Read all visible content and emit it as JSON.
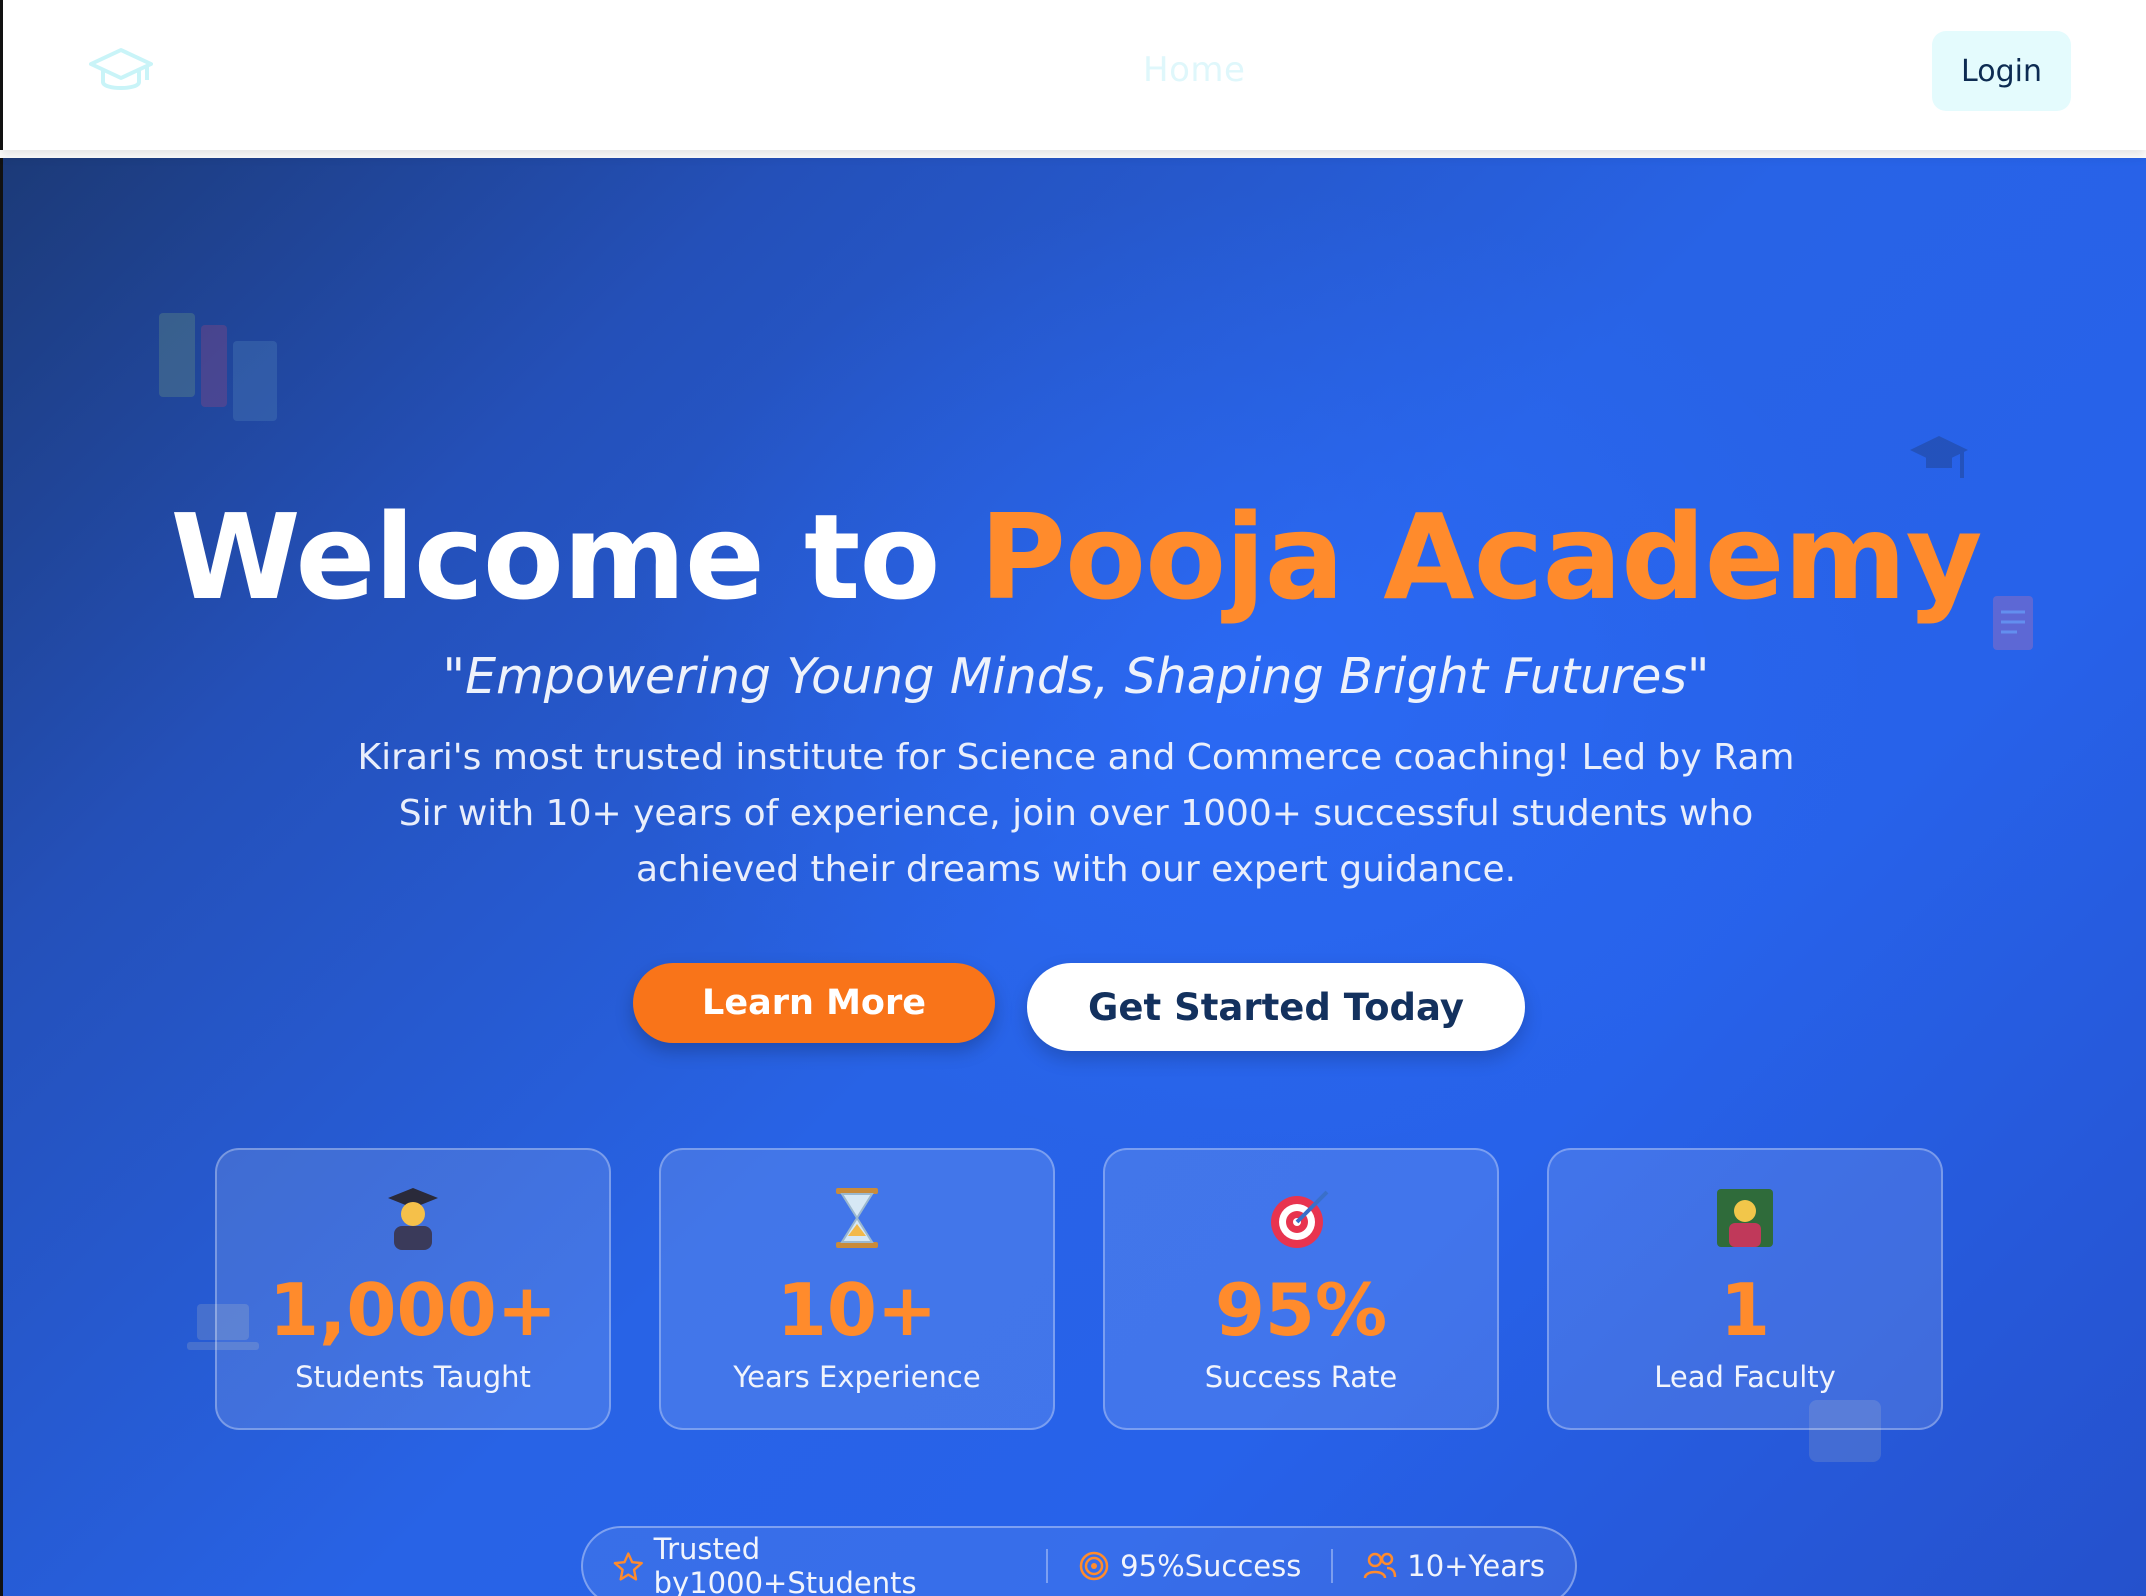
{
  "nav": {
    "logo_icon": "graduation-cap-icon",
    "home_label": "Home",
    "login_label": "Login"
  },
  "hero": {
    "title_main": "Welcome to ",
    "title_accent": "Pooja Academy",
    "tagline": "\"Empowering Young Minds, Shaping Bright Futures\"",
    "description": "Kirari's most trusted institute for Science and Commerce coaching! Led by Ram Sir with 10+ years of experience, join over 1000+ successful students who achieved their dreams with our expert guidance.",
    "learn_more_label": "Learn More",
    "get_started_label": "Get Started Today"
  },
  "stats": [
    {
      "icon": "graduate-icon",
      "value": "1,000+",
      "label": "Students Taught"
    },
    {
      "icon": "hourglass-icon",
      "value": "10+",
      "label": "Years Experience"
    },
    {
      "icon": "target-icon",
      "value": "95%",
      "label": "Success Rate"
    },
    {
      "icon": "teacher-icon",
      "value": "1",
      "label": "Lead Faculty"
    }
  ],
  "trust": [
    {
      "icon": "star-icon",
      "label": "Trusted by1000+Students"
    },
    {
      "icon": "target-icon",
      "label": "95%Success"
    },
    {
      "icon": "users-icon",
      "label": "10+Years"
    }
  ],
  "colors": {
    "accent": "#ff8b2c",
    "primary_button": "#f97419",
    "hero_blue": "#2863e6",
    "login_bg": "#e4fbfd",
    "dark_text": "#13315e"
  }
}
